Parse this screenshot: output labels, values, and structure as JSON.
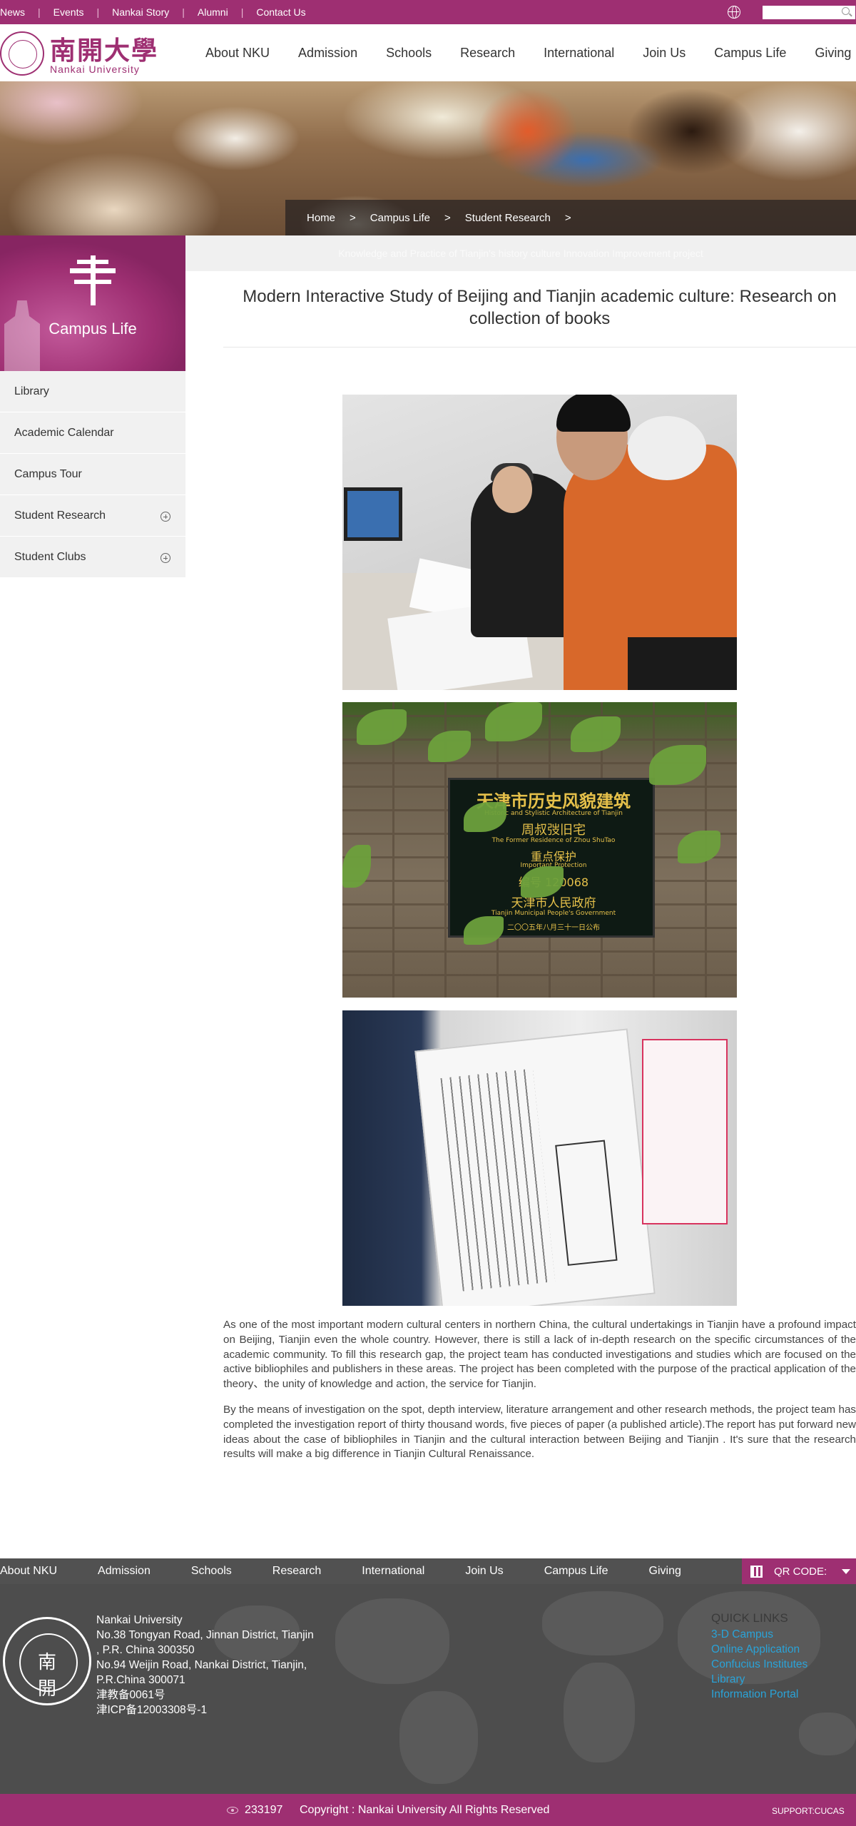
{
  "topbar": {
    "links": [
      "News",
      "Events",
      "Nankai Story",
      "Alumni",
      "Contact Us"
    ],
    "search_placeholder": ""
  },
  "header": {
    "logo_cn": "南開大學",
    "logo_en": "Nankai University",
    "nav": [
      "About NKU",
      "Admission",
      "Schools",
      "Research",
      "International",
      "Join Us",
      "Campus Life",
      "Giving"
    ]
  },
  "breadcrumb": [
    "Home",
    "Campus Life",
    "Student Research"
  ],
  "breadcrumb_sep": ">",
  "sidebar": {
    "title": "Campus Life",
    "items": [
      {
        "label": "Library",
        "expandable": false
      },
      {
        "label": "Academic Calendar",
        "expandable": false
      },
      {
        "label": "Campus Tour",
        "expandable": false
      },
      {
        "label": "Student Research",
        "expandable": true
      },
      {
        "label": "Student Clubs",
        "expandable": true
      }
    ]
  },
  "article": {
    "subband": "Knowledge and Practice of Tianjin's history culture   Innovation Improvement project",
    "title": "Modern Interactive Study of Beijing and Tianjin academic culture: Research on collection of books",
    "plaque": {
      "line1": "天津市历史风貌建筑",
      "line2": "Historic and Stylistic Architecture of Tianjin",
      "line3": "周叔弢旧宅",
      "line4": "The Former Residence of Zhou ShuTao",
      "line5": "重点保护",
      "line6": "Important Protection",
      "line7": "编号 120068",
      "line8": "天津市人民政府",
      "line9": "Tianjin Municipal People's Government",
      "line10": "二〇〇五年八月三十一日公布"
    },
    "paragraphs": [
      "As one of the most important modern cultural centers in northern China, the cultural undertakings in Tianjin have a profound impact on Beijing, Tianjin even the whole country. However, there is still a lack of in-depth research on the specific circumstances of the academic community. To fill this research gap, the project team has conducted investigations and studies which are focused on the active bibliophiles and publishers in these areas. The project has been completed with the purpose of the practical application of the theory、the unity of knowledge and action, the service for Tianjin.",
      "By the means of investigation on the spot, depth interview, literature arrangement and other research methods, the project team has completed the investigation report of thirty thousand words, five pieces of paper (a published article).The report has put forward new ideas about the case of bibliophiles in Tianjin and the cultural interaction between Beijing and Tianjin . It's sure that the research results will make a big difference in Tianjin Cultural Renaissance."
    ]
  },
  "footer": {
    "nav": [
      "About NKU",
      "Admission",
      "Schools",
      "Research",
      "International",
      "Join Us",
      "Campus Life",
      "Giving"
    ],
    "qr_label": "QR CODE:",
    "seal_cn": "南開",
    "address": [
      "Nankai University",
      "No.38 Tongyan Road, Jinnan District, Tianjin",
      ", P.R. China 300350",
      "No.94 Weijin Road,  Nankai District, Tianjin,",
      "P.R.China  300071",
      "津教备0061号",
      "津ICP备12003308号-1"
    ],
    "quick_links_title": "QUICK LINKS",
    "quick_links": [
      "3-D Campus",
      "Online Application",
      "Confucius Institutes",
      "Library",
      "Information Portal"
    ],
    "visit_count": "233197",
    "copyright": "Copyright : Nankai University All Rights Reserved",
    "support": "SUPPORT:CUCAS"
  },
  "colors": {
    "brand": "#9e2f72",
    "footer": "#4d4d4d",
    "link": "#2aa3d8"
  }
}
